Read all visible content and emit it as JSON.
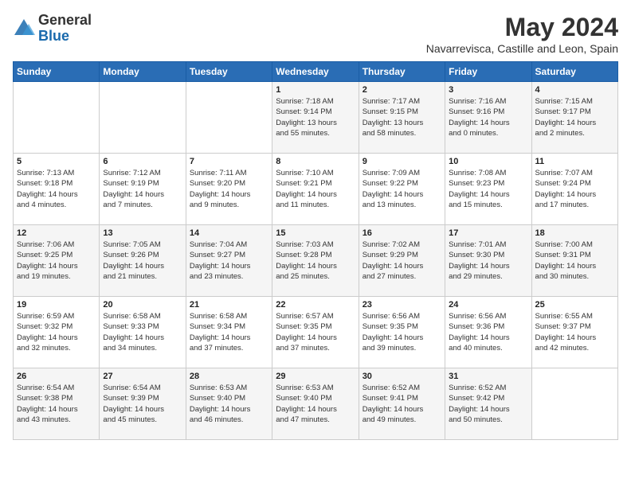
{
  "header": {
    "logo_general": "General",
    "logo_blue": "Blue",
    "month_title": "May 2024",
    "location": "Navarrevisca, Castille and Leon, Spain"
  },
  "weekdays": [
    "Sunday",
    "Monday",
    "Tuesday",
    "Wednesday",
    "Thursday",
    "Friday",
    "Saturday"
  ],
  "weeks": [
    [
      {
        "day": "",
        "info": ""
      },
      {
        "day": "",
        "info": ""
      },
      {
        "day": "",
        "info": ""
      },
      {
        "day": "1",
        "info": "Sunrise: 7:18 AM\nSunset: 9:14 PM\nDaylight: 13 hours\nand 55 minutes."
      },
      {
        "day": "2",
        "info": "Sunrise: 7:17 AM\nSunset: 9:15 PM\nDaylight: 13 hours\nand 58 minutes."
      },
      {
        "day": "3",
        "info": "Sunrise: 7:16 AM\nSunset: 9:16 PM\nDaylight: 14 hours\nand 0 minutes."
      },
      {
        "day": "4",
        "info": "Sunrise: 7:15 AM\nSunset: 9:17 PM\nDaylight: 14 hours\nand 2 minutes."
      }
    ],
    [
      {
        "day": "5",
        "info": "Sunrise: 7:13 AM\nSunset: 9:18 PM\nDaylight: 14 hours\nand 4 minutes."
      },
      {
        "day": "6",
        "info": "Sunrise: 7:12 AM\nSunset: 9:19 PM\nDaylight: 14 hours\nand 7 minutes."
      },
      {
        "day": "7",
        "info": "Sunrise: 7:11 AM\nSunset: 9:20 PM\nDaylight: 14 hours\nand 9 minutes."
      },
      {
        "day": "8",
        "info": "Sunrise: 7:10 AM\nSunset: 9:21 PM\nDaylight: 14 hours\nand 11 minutes."
      },
      {
        "day": "9",
        "info": "Sunrise: 7:09 AM\nSunset: 9:22 PM\nDaylight: 14 hours\nand 13 minutes."
      },
      {
        "day": "10",
        "info": "Sunrise: 7:08 AM\nSunset: 9:23 PM\nDaylight: 14 hours\nand 15 minutes."
      },
      {
        "day": "11",
        "info": "Sunrise: 7:07 AM\nSunset: 9:24 PM\nDaylight: 14 hours\nand 17 minutes."
      }
    ],
    [
      {
        "day": "12",
        "info": "Sunrise: 7:06 AM\nSunset: 9:25 PM\nDaylight: 14 hours\nand 19 minutes."
      },
      {
        "day": "13",
        "info": "Sunrise: 7:05 AM\nSunset: 9:26 PM\nDaylight: 14 hours\nand 21 minutes."
      },
      {
        "day": "14",
        "info": "Sunrise: 7:04 AM\nSunset: 9:27 PM\nDaylight: 14 hours\nand 23 minutes."
      },
      {
        "day": "15",
        "info": "Sunrise: 7:03 AM\nSunset: 9:28 PM\nDaylight: 14 hours\nand 25 minutes."
      },
      {
        "day": "16",
        "info": "Sunrise: 7:02 AM\nSunset: 9:29 PM\nDaylight: 14 hours\nand 27 minutes."
      },
      {
        "day": "17",
        "info": "Sunrise: 7:01 AM\nSunset: 9:30 PM\nDaylight: 14 hours\nand 29 minutes."
      },
      {
        "day": "18",
        "info": "Sunrise: 7:00 AM\nSunset: 9:31 PM\nDaylight: 14 hours\nand 30 minutes."
      }
    ],
    [
      {
        "day": "19",
        "info": "Sunrise: 6:59 AM\nSunset: 9:32 PM\nDaylight: 14 hours\nand 32 minutes."
      },
      {
        "day": "20",
        "info": "Sunrise: 6:58 AM\nSunset: 9:33 PM\nDaylight: 14 hours\nand 34 minutes."
      },
      {
        "day": "21",
        "info": "Sunrise: 6:58 AM\nSunset: 9:34 PM\nDaylight: 14 hours\nand 37 minutes."
      },
      {
        "day": "22",
        "info": "Sunrise: 6:57 AM\nSunset: 9:35 PM\nDaylight: 14 hours\nand 37 minutes."
      },
      {
        "day": "23",
        "info": "Sunrise: 6:56 AM\nSunset: 9:35 PM\nDaylight: 14 hours\nand 39 minutes."
      },
      {
        "day": "24",
        "info": "Sunrise: 6:56 AM\nSunset: 9:36 PM\nDaylight: 14 hours\nand 40 minutes."
      },
      {
        "day": "25",
        "info": "Sunrise: 6:55 AM\nSunset: 9:37 PM\nDaylight: 14 hours\nand 42 minutes."
      }
    ],
    [
      {
        "day": "26",
        "info": "Sunrise: 6:54 AM\nSunset: 9:38 PM\nDaylight: 14 hours\nand 43 minutes."
      },
      {
        "day": "27",
        "info": "Sunrise: 6:54 AM\nSunset: 9:39 PM\nDaylight: 14 hours\nand 45 minutes."
      },
      {
        "day": "28",
        "info": "Sunrise: 6:53 AM\nSunset: 9:40 PM\nDaylight: 14 hours\nand 46 minutes."
      },
      {
        "day": "29",
        "info": "Sunrise: 6:53 AM\nSunset: 9:40 PM\nDaylight: 14 hours\nand 47 minutes."
      },
      {
        "day": "30",
        "info": "Sunrise: 6:52 AM\nSunset: 9:41 PM\nDaylight: 14 hours\nand 49 minutes."
      },
      {
        "day": "31",
        "info": "Sunrise: 6:52 AM\nSunset: 9:42 PM\nDaylight: 14 hours\nand 50 minutes."
      },
      {
        "day": "",
        "info": ""
      }
    ]
  ]
}
